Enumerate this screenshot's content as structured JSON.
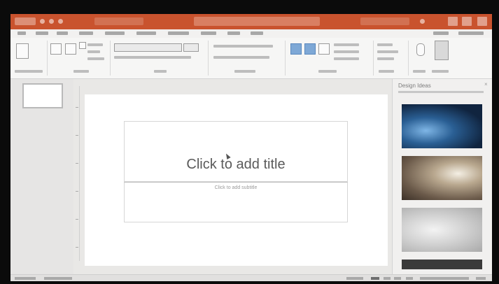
{
  "slide": {
    "title_placeholder": "Click to add title",
    "subtitle_placeholder": "Click to add subtitle"
  },
  "design_pane": {
    "title": "Design Ideas",
    "close": "×",
    "ideas": [
      {
        "name": "blue-light-theme"
      },
      {
        "name": "sunburst-theme"
      },
      {
        "name": "gray-texture-theme"
      },
      {
        "name": "dark-theme"
      }
    ]
  },
  "colors": {
    "title_bar": "#c9532e",
    "app_background": "#ecebea"
  },
  "icons": [
    "new-slide-icon",
    "layout-icon",
    "shape-icon",
    "design-ideas-icon",
    "close-icon"
  ]
}
